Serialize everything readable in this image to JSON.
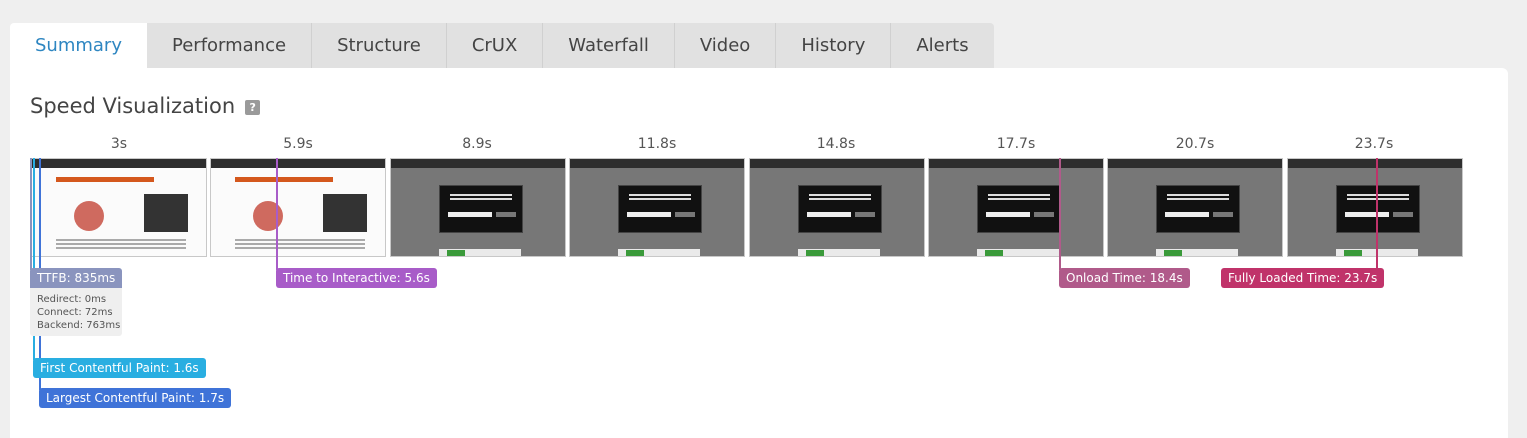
{
  "tabs": [
    {
      "label": "Summary",
      "active": true
    },
    {
      "label": "Performance"
    },
    {
      "label": "Structure"
    },
    {
      "label": "CrUX"
    },
    {
      "label": "Waterfall"
    },
    {
      "label": "Video"
    },
    {
      "label": "History"
    },
    {
      "label": "Alerts"
    }
  ],
  "section": {
    "title": "Speed Visualization",
    "help_label": "?"
  },
  "timeline": {
    "frames": [
      {
        "time": "3s",
        "state": "loading"
      },
      {
        "time": "5.9s",
        "state": "loading"
      },
      {
        "time": "8.9s",
        "state": "modal"
      },
      {
        "time": "11.8s",
        "state": "modal"
      },
      {
        "time": "14.8s",
        "state": "modal"
      },
      {
        "time": "17.7s",
        "state": "modal"
      },
      {
        "time": "20.7s",
        "state": "modal"
      },
      {
        "time": "23.7s",
        "state": "modal"
      }
    ]
  },
  "metrics": {
    "ttfb": {
      "label": "TTFB: 835ms",
      "color": "#8a94be"
    },
    "ttfb_details": {
      "redirect": "Redirect: 0ms",
      "connect": "Connect: 72ms",
      "backend": "Backend: 763ms"
    },
    "fcp": {
      "label": "First Contentful Paint: 1.6s",
      "color": "#29aee1"
    },
    "lcp": {
      "label": "Largest Contentful Paint: 1.7s",
      "color": "#3f73d8"
    },
    "tti": {
      "label": "Time to Interactive: 5.6s",
      "color": "#a85cc8"
    },
    "onload": {
      "label": "Onload Time: 18.4s",
      "color": "#b05a8a"
    },
    "fully_loaded": {
      "label": "Fully Loaded Time: 23.7s",
      "color": "#c0336a"
    }
  }
}
